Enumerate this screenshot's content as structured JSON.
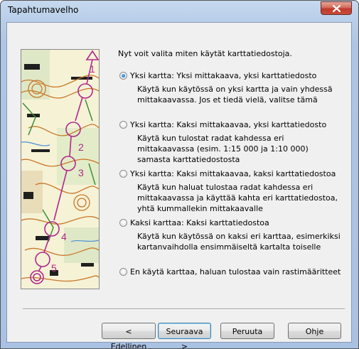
{
  "window": {
    "title": "Tapahtumavelho"
  },
  "intro": "Nyt voit valita miten käytät karttatiedostoja.",
  "options": [
    {
      "label": "Yksi kartta: Yksi mittakaava, yksi karttatiedosto",
      "desc": [
        "Käytä kun käytössä on yksi kartta ja vain yhdessä",
        "mittakaavassa. Jos et tiedä vielä, valitse tämä"
      ],
      "checked": true
    },
    {
      "label": "Yksi kartta: Kaksi mittakaavaa, yksi karttatiedosto",
      "desc": [
        "Käytä kun tulostat radat kahdessa eri",
        "mittakaavassa (esim. 1:15 000 ja 1:10 000)",
        "samasta karttatiedostosta"
      ],
      "checked": false
    },
    {
      "label": "Yksi kartta: Kaksi mittakaavaa, kaksi karttatiedostoa",
      "desc": [
        "Käytä kun haluat tulostaa radat kahdessa eri",
        "mittakaavassa ja käyttää kahta eri karttatiedostoa,",
        "yhtä kummallekin mittakaavalle"
      ],
      "checked": false
    },
    {
      "label": "Kaksi karttaa: Kaksi karttatiedostoa",
      "desc": [
        "Käytä kun käytössä on kaksi eri karttaa, esimerkiksi",
        "kartanvaihdolla ensimmäiseltä kartalta toiselle"
      ],
      "checked": false
    },
    {
      "label": "En käytä karttaa, haluan tulostaa vain rastimääritteet",
      "desc": [],
      "checked": false
    }
  ],
  "map_panel": {
    "control_numbers": [
      "1",
      "2",
      "3",
      "4",
      "5"
    ]
  },
  "buttons": {
    "back": "< Edellinen",
    "next": "Seuraava >",
    "cancel": "Peruuta",
    "help": "Ohje"
  },
  "colors": {
    "accent_course": "#b0288c",
    "contour": "#c8782a",
    "vegetation": "#2e8b2e"
  }
}
